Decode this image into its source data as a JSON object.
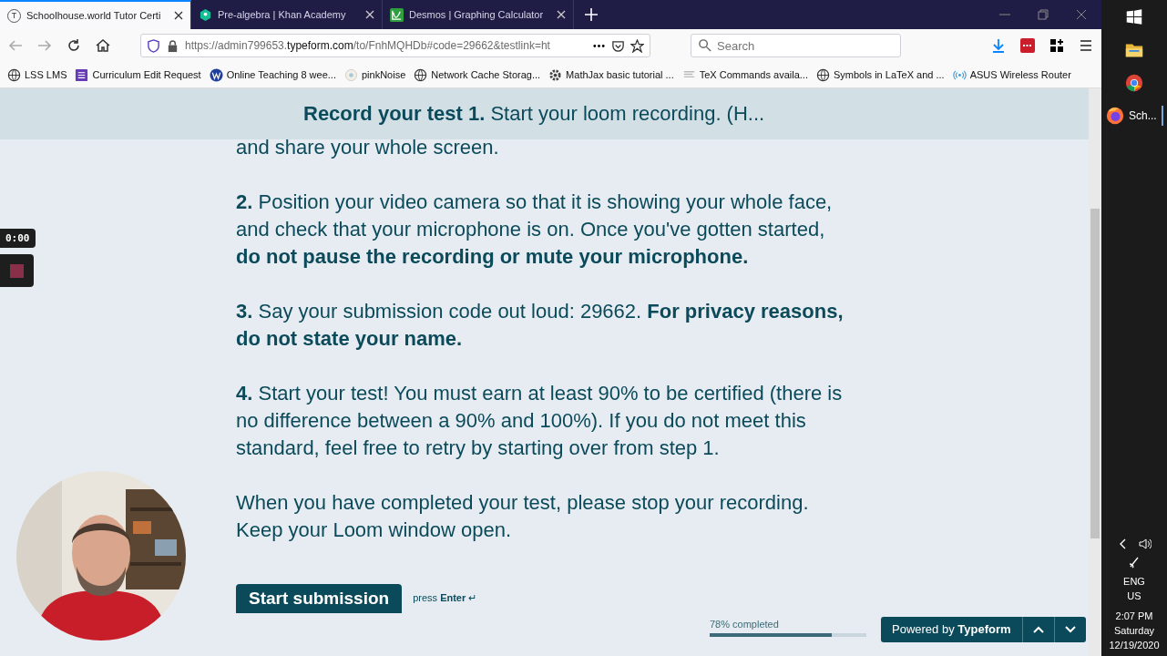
{
  "tabs": [
    {
      "title": "Schoolhouse.world Tutor Certi",
      "favicon_letter": "T",
      "kind": "letter",
      "selected": true
    },
    {
      "title": "Pre-algebra | Khan Academy",
      "kind": "hexagon",
      "selected": false
    },
    {
      "title": "Desmos | Graphing Calculator",
      "kind": "graph",
      "selected": false
    }
  ],
  "address": {
    "prefix": "https://admin799653.",
    "domain": "typeform.com",
    "path": "/to/FnhMQHDb#code=29662&testlink=ht"
  },
  "search": {
    "placeholder": "Search"
  },
  "bookmarks": [
    {
      "label": "LSS LMS",
      "kind": "globe"
    },
    {
      "label": "Curriculum Edit Request",
      "kind": "form"
    },
    {
      "label": "Online Teaching 8 wee...",
      "kind": "w"
    },
    {
      "label": "pinkNoise",
      "kind": "circle"
    },
    {
      "label": "Network Cache Storag...",
      "kind": "globe"
    },
    {
      "label": "MathJax basic tutorial ...",
      "kind": "gear"
    },
    {
      "label": "TeX Commands availa...",
      "kind": "page"
    },
    {
      "label": "Symbols in LaTeX and ...",
      "kind": "globe"
    },
    {
      "label": "ASUS Wireless Router",
      "kind": "wifi"
    }
  ],
  "sticky_header": "**Record your test 1.** Start your loom recording. (H...",
  "paragraphs": [
    "and share your whole screen.",
    "**2.** Position your video camera so that it is showing your whole face, and check that your microphone is on. Once you've gotten started, **do not pause the recording or mute your microphone.**",
    "**3.** Say your submission code out loud: 29662. **For privacy reasons, do not state your name.**",
    "**4.** Start your test! You must earn at least 90% to be certified (there is no difference between a 90% and 100%). If you do not meet this standard, feel free to retry by starting over from step 1.",
    "When you have completed your test, please stop your recording. Keep your Loom window open."
  ],
  "loom": {
    "timer": "0:00"
  },
  "submit": {
    "label": "Start submission",
    "hint": "press **Enter** ↵"
  },
  "progress": {
    "label": "78% completed",
    "level": 0.78
  },
  "powered": "Powered by **Typeform**",
  "taskbar": {
    "apps": [
      {
        "kind": "folder"
      },
      {
        "kind": "chrome"
      },
      {
        "kind": "firefox",
        "label": "Sch..."
      }
    ],
    "language": [
      "ENG",
      "US"
    ],
    "clock": [
      "2:07 PM",
      "Saturday",
      "12/19/2020"
    ]
  }
}
